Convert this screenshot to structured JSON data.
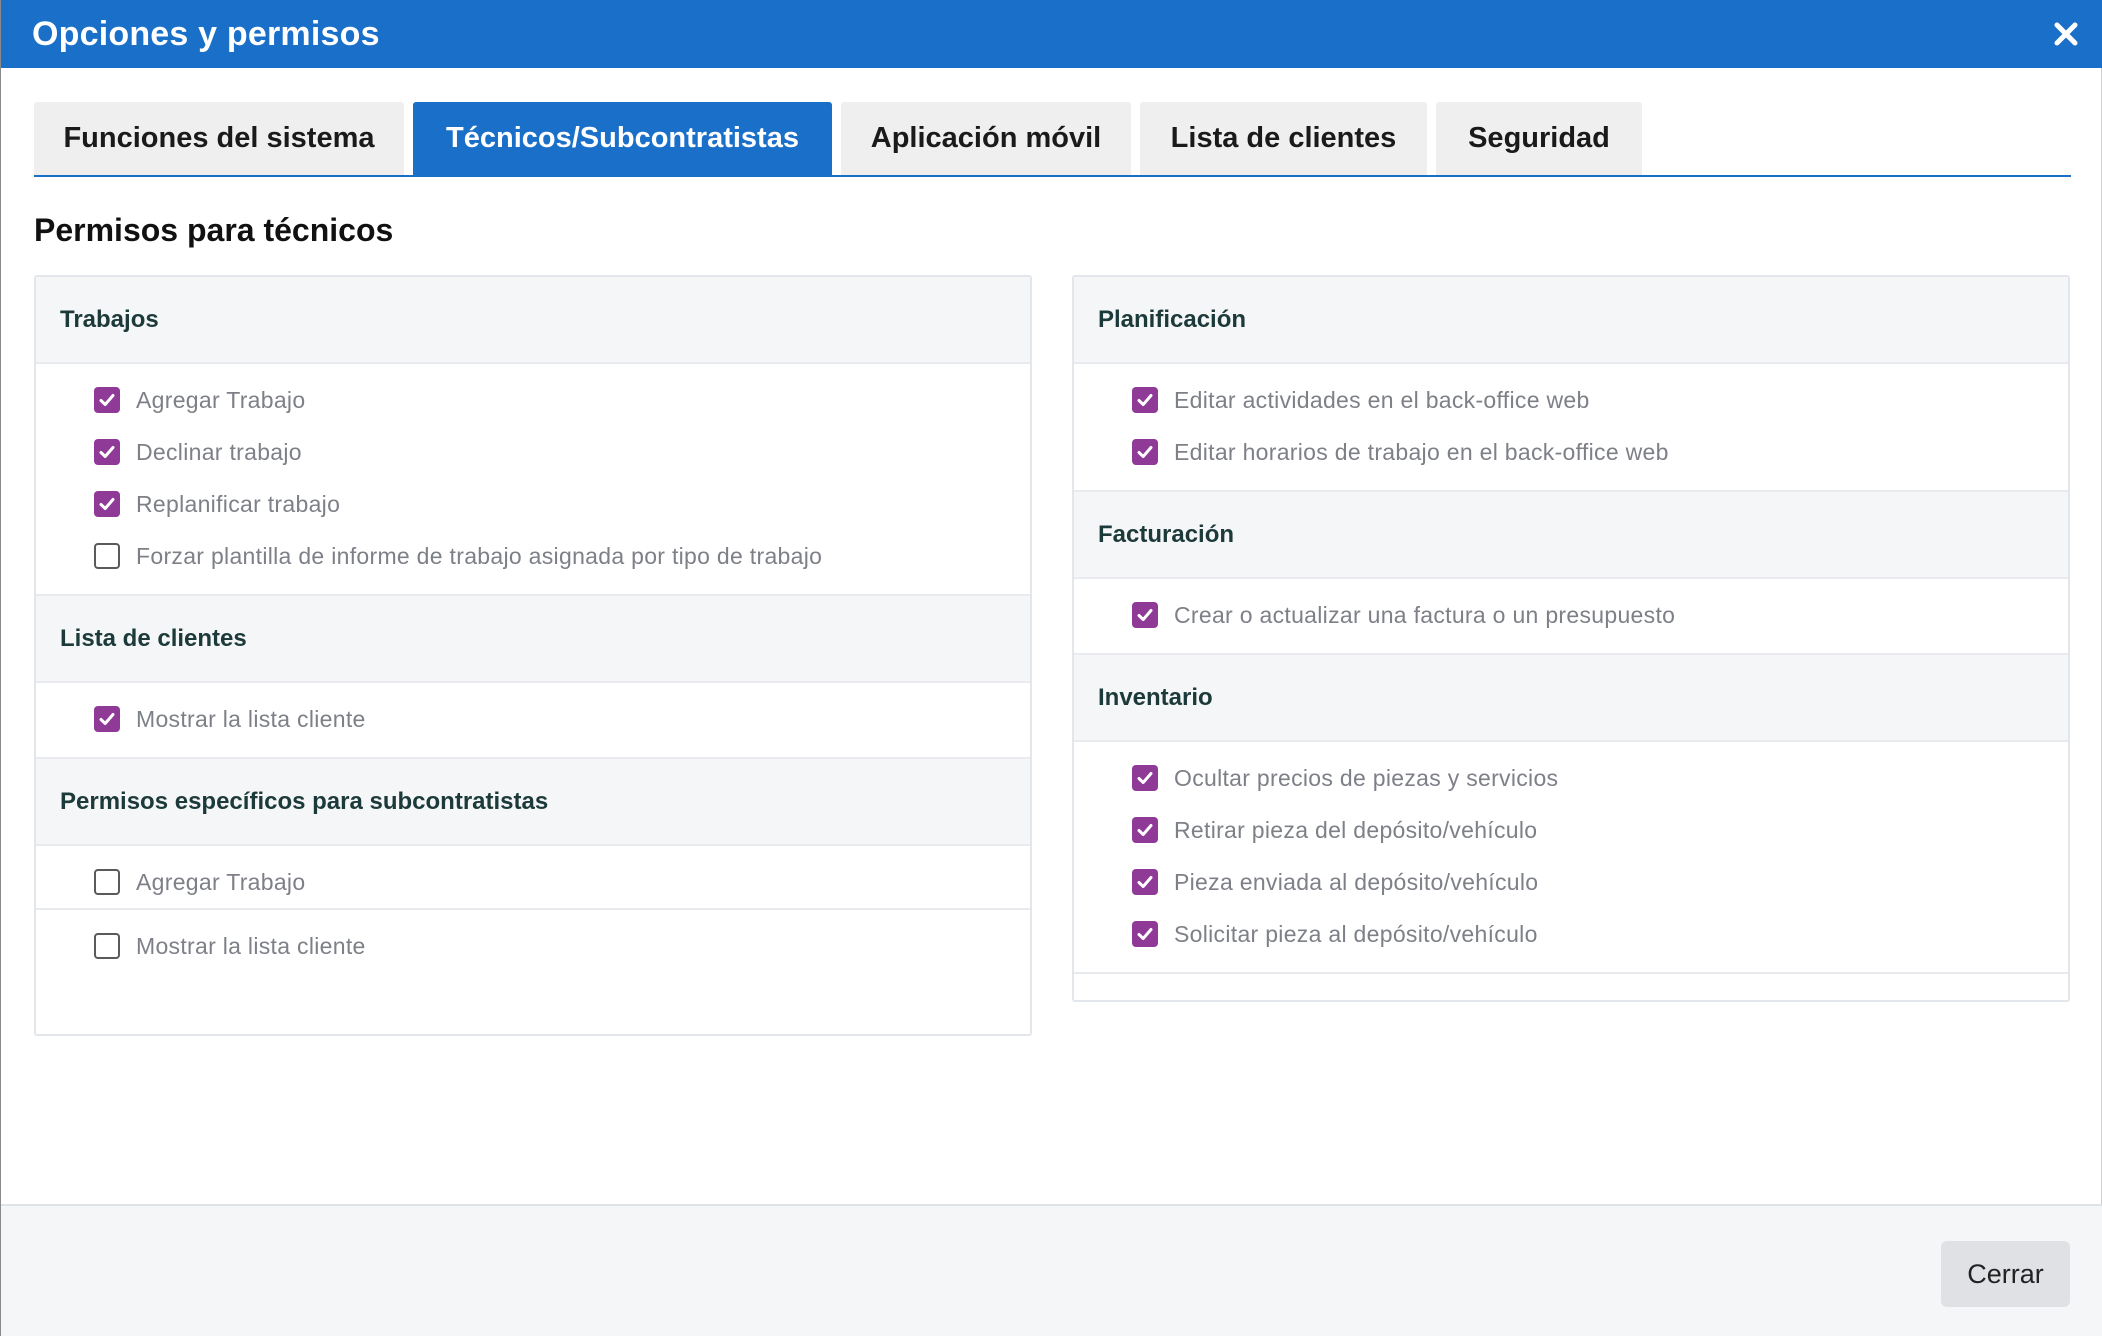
{
  "dialog": {
    "title": "Opciones y permisos",
    "close_icon": "close-x-icon"
  },
  "tabs": [
    {
      "label": "Funciones del sistema",
      "active": false
    },
    {
      "label": "Técnicos/Subcontratistas",
      "active": true
    },
    {
      "label": "Aplicación móvil",
      "active": false
    },
    {
      "label": "Lista de clientes",
      "active": false
    },
    {
      "label": "Seguridad",
      "active": false
    }
  ],
  "main": {
    "section_title": "Permisos para técnicos",
    "left_groups": [
      {
        "title": "Trabajos",
        "items": [
          {
            "label": "Agregar Trabajo",
            "checked": true
          },
          {
            "label": "Declinar trabajo",
            "checked": true
          },
          {
            "label": "Replanificar trabajo",
            "checked": true
          },
          {
            "label": "Forzar plantilla de informe de trabajo asignada por tipo de trabajo",
            "checked": false
          }
        ]
      },
      {
        "title": "Lista de clientes",
        "items": [
          {
            "label": "Mostrar la lista cliente",
            "checked": true
          }
        ]
      },
      {
        "title": "Permisos específicos para subcontratistas",
        "items": [
          {
            "label": "Agregar Trabajo",
            "checked": false
          },
          {
            "label": "Mostrar la lista cliente",
            "checked": false
          }
        ]
      }
    ],
    "right_groups": [
      {
        "title": "Planificación",
        "items": [
          {
            "label": "Editar actividades en el back-office web",
            "checked": true
          },
          {
            "label": "Editar horarios de trabajo en el back-office web",
            "checked": true
          }
        ]
      },
      {
        "title": "Facturación",
        "items": [
          {
            "label": "Crear o actualizar una factura o un presupuesto",
            "checked": true
          }
        ]
      },
      {
        "title": "Inventario",
        "items": [
          {
            "label": "Ocultar precios de piezas y servicios",
            "checked": true
          },
          {
            "label": "Retirar pieza del depósito/vehículo",
            "checked": true
          },
          {
            "label": "Pieza enviada al depósito/vehículo",
            "checked": true
          },
          {
            "label": "Solicitar pieza al depósito/vehículo",
            "checked": true
          }
        ]
      }
    ]
  },
  "footer": {
    "close_label": "Cerrar"
  },
  "colors": {
    "accent": "#1a6fc9",
    "checkbox_checked": "#8e3a96",
    "label_text": "#7d8087",
    "group_header_bg": "#f5f6f8"
  }
}
